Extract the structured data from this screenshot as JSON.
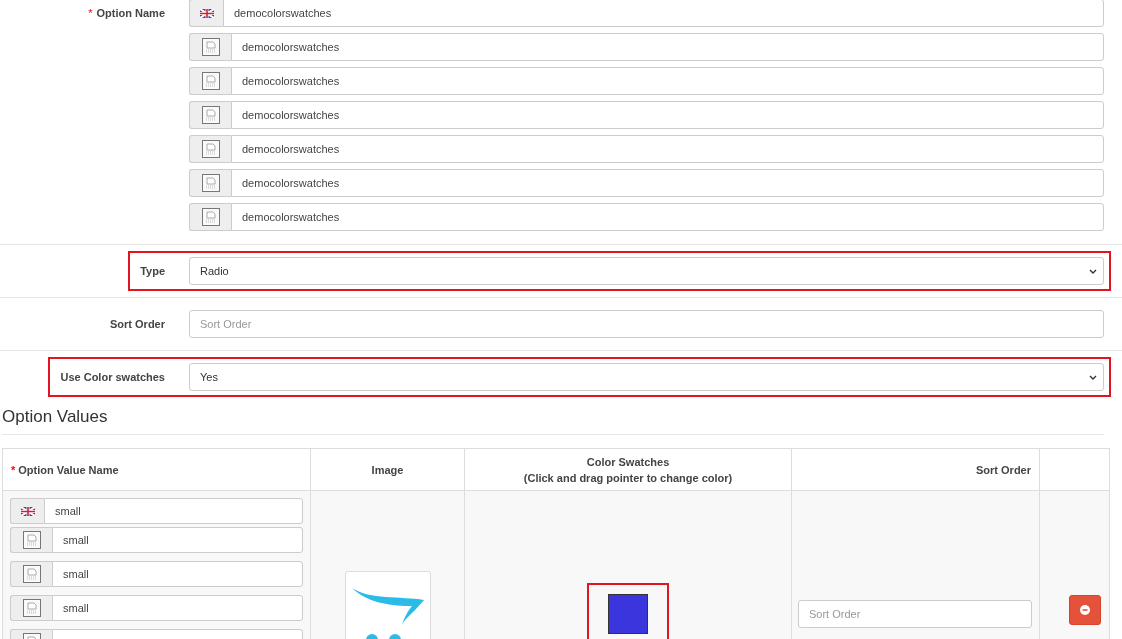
{
  "option_name": {
    "required_mark": "*",
    "label": "Option Name",
    "values": [
      {
        "kind": "flag",
        "value": "democolorswatches"
      },
      {
        "kind": "language",
        "value": "democolorswatches"
      },
      {
        "kind": "language",
        "value": "democolorswatches"
      },
      {
        "kind": "language",
        "value": "democolorswatches"
      },
      {
        "kind": "language",
        "value": "democolorswatches"
      },
      {
        "kind": "language",
        "value": "democolorswatches"
      },
      {
        "kind": "language",
        "value": "democolorswatches"
      }
    ]
  },
  "type": {
    "label": "Type",
    "value": "Radio",
    "highlighted": true
  },
  "sort_order": {
    "label": "Sort Order",
    "placeholder": "Sort Order"
  },
  "use_color_swatches": {
    "label": "Use Color swatches",
    "value": "Yes",
    "highlighted": true
  },
  "option_values": {
    "title": "Option Values",
    "columns": [
      {
        "required_mark": "*",
        "label": "Option Value Name"
      },
      {
        "label": "Image"
      },
      {
        "label": "Color Swatches",
        "sublabel": "(Click and drag pointer to change color)"
      },
      {
        "label": "Sort Order"
      }
    ],
    "rows": [
      {
        "names": [
          {
            "kind": "flag",
            "value": "small"
          },
          {
            "kind": "language",
            "value": "small"
          },
          {
            "kind": "language",
            "value": "small"
          },
          {
            "kind": "language",
            "value": "small"
          },
          {
            "kind": "language"
          }
        ],
        "swatch": {
          "color": "#3a35dc",
          "highlighted": true
        },
        "sort_order": {
          "placeholder": "Sort Order"
        }
      }
    ]
  }
}
